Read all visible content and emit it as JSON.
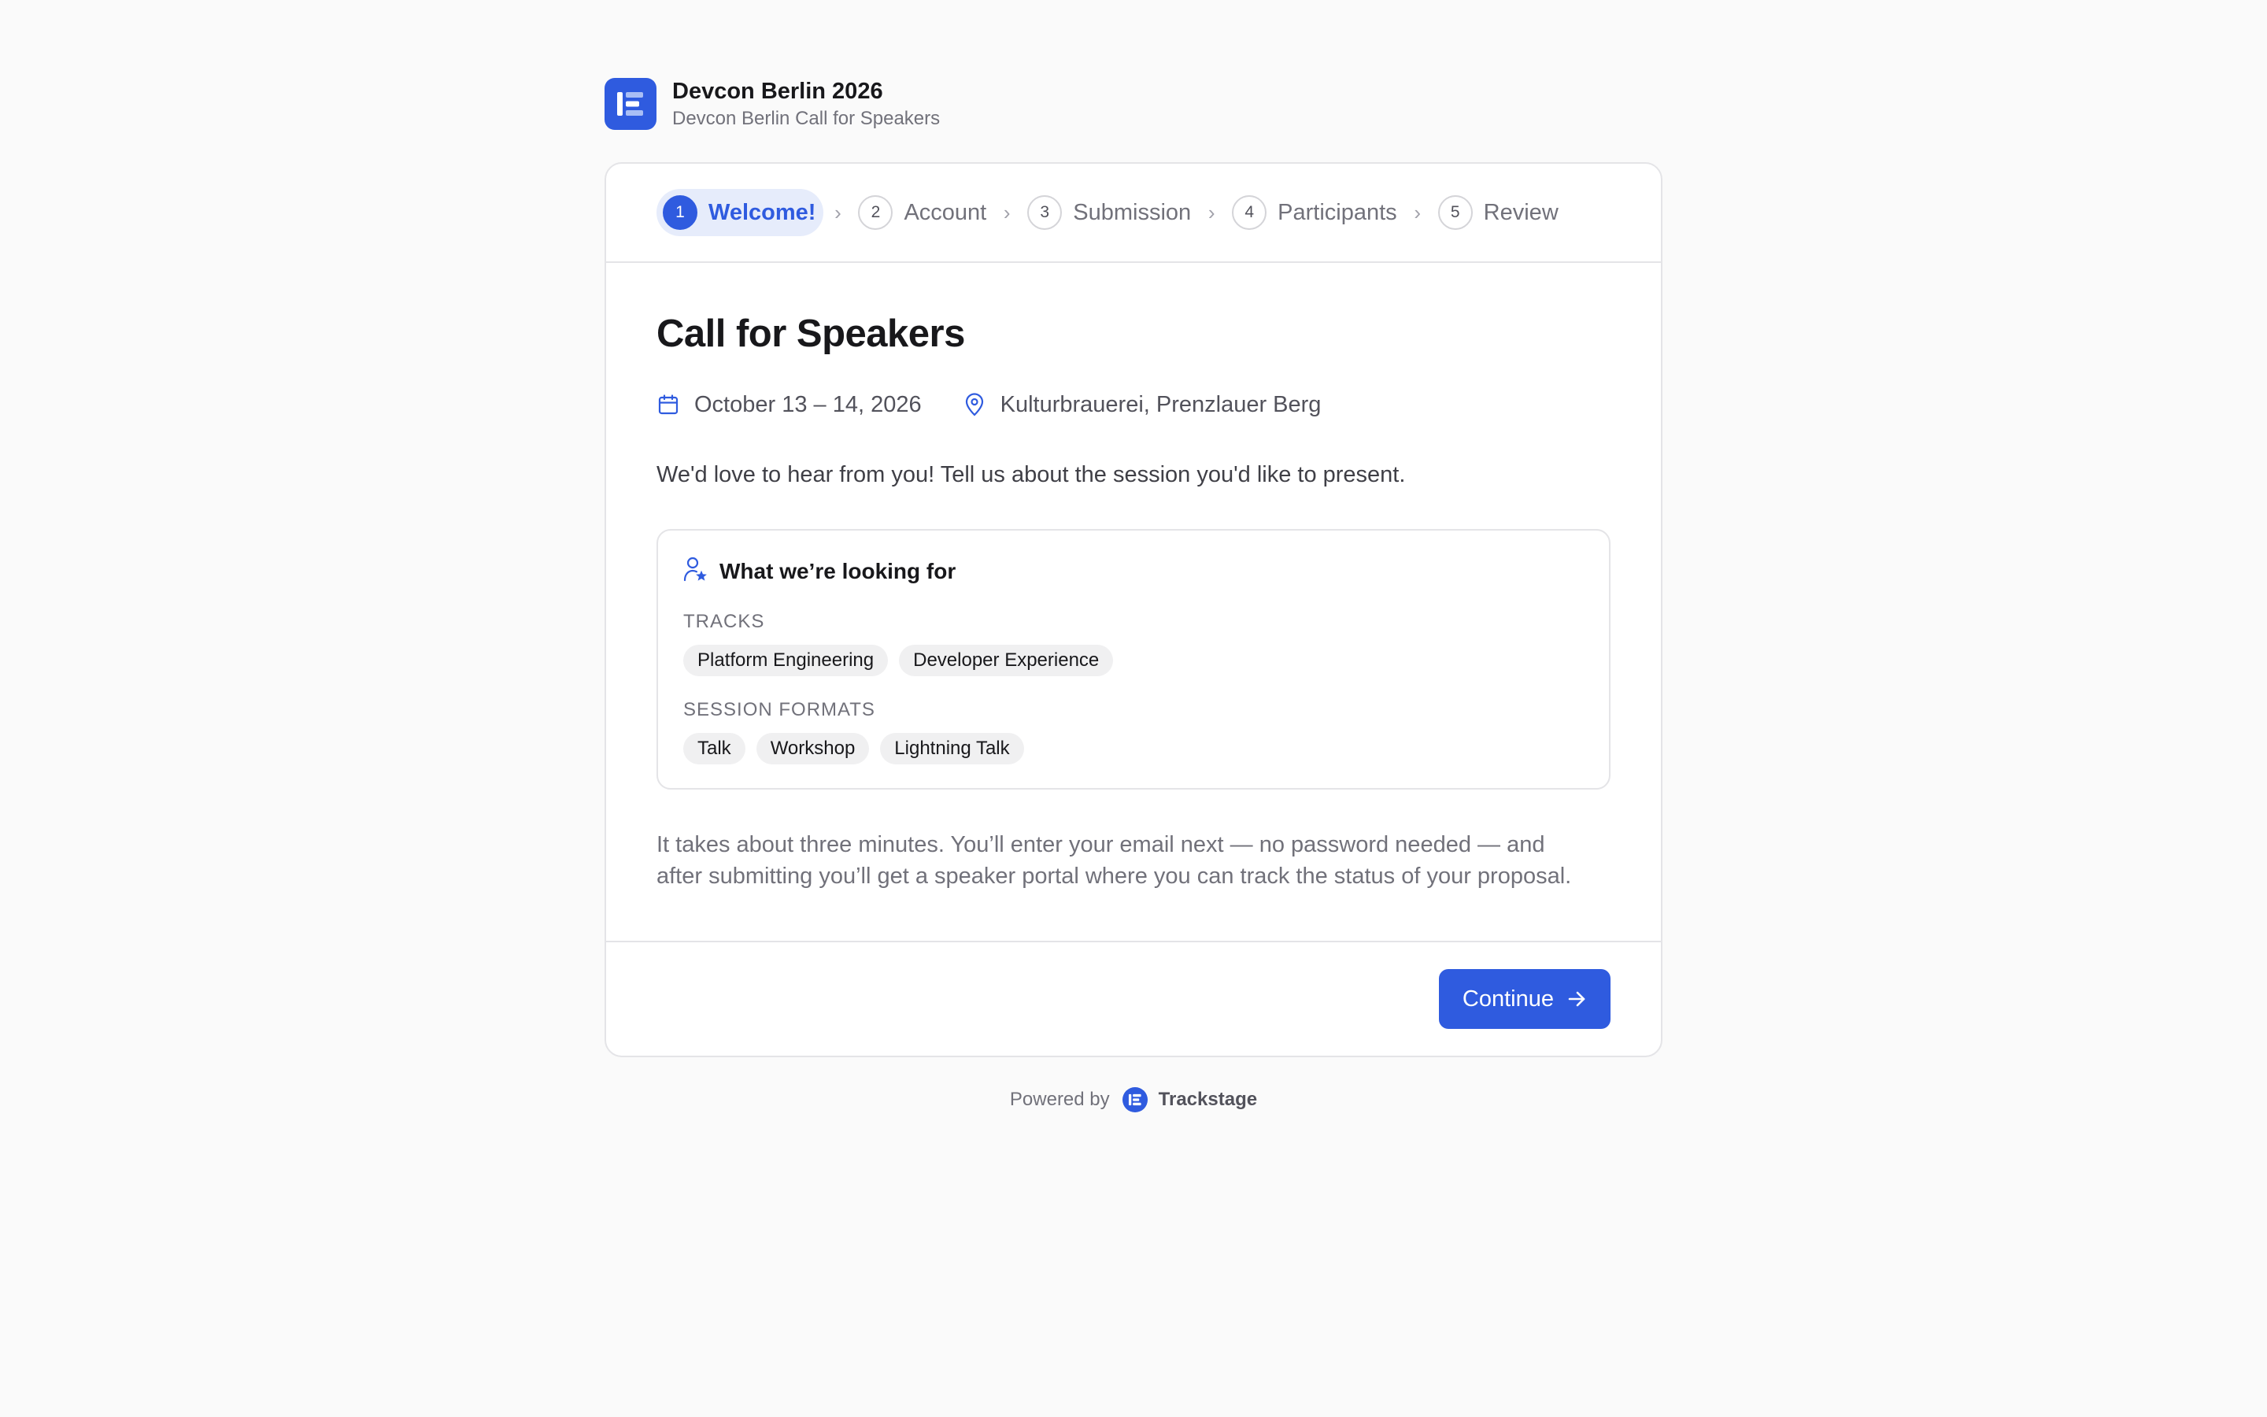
{
  "event": {
    "name": "Devcon Berlin 2026",
    "subtitle": "Devcon Berlin Call for Speakers"
  },
  "steps": [
    {
      "num": "1",
      "label": "Welcome!"
    },
    {
      "num": "2",
      "label": "Account"
    },
    {
      "num": "3",
      "label": "Submission"
    },
    {
      "num": "4",
      "label": "Participants"
    },
    {
      "num": "5",
      "label": "Review"
    }
  ],
  "main": {
    "title": "Call for Speakers",
    "date": "October 13 – 14, 2026",
    "location": "Kulturbrauerei, Prenzlauer Berg",
    "intro": "We'd love to hear from you! Tell us about the session you'd like to present.",
    "lookfor": {
      "title": "What we’re looking for",
      "tracks_label": "TRACKS",
      "tracks": [
        "Platform Engineering",
        "Developer Experience"
      ],
      "formats_label": "SESSION FORMATS",
      "formats": [
        "Talk",
        "Workshop",
        "Lightning Talk"
      ]
    },
    "outro_line1": "It takes about three minutes. You’ll enter your email next — no password needed — and",
    "outro_line2": "after submitting you’ll get a speaker portal where you can track the status of your proposal."
  },
  "footer": {
    "continue_label": "Continue",
    "powered_by": "Powered by",
    "brand": "Trackstage"
  },
  "colors": {
    "accent": "#2f5bdf",
    "background": "#fafafa"
  }
}
